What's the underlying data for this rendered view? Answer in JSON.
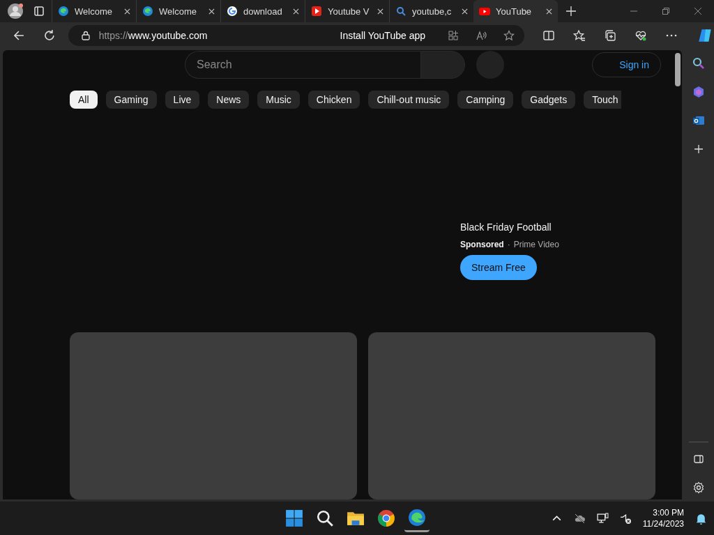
{
  "tabs": [
    {
      "title": "Welcome",
      "kind": "edge",
      "selected": false
    },
    {
      "title": "Welcome",
      "kind": "edge",
      "selected": false
    },
    {
      "title": "download",
      "kind": "google",
      "selected": false
    },
    {
      "title": "Youtube V",
      "kind": "play-square",
      "selected": false
    },
    {
      "title": "youtube,c",
      "kind": "search",
      "selected": false
    },
    {
      "title": "YouTube",
      "kind": "youtube",
      "selected": true
    }
  ],
  "address_bar": {
    "url_scheme": "https://",
    "url_host": "www.youtube.com",
    "install_label": "Install YouTube app"
  },
  "page": {
    "search": {
      "placeholder": "Search"
    },
    "sign_in": "Sign in",
    "chips": [
      {
        "label": "All",
        "selected": true
      },
      {
        "label": "Gaming",
        "selected": false
      },
      {
        "label": "Live",
        "selected": false
      },
      {
        "label": "News",
        "selected": false
      },
      {
        "label": "Music",
        "selected": false
      },
      {
        "label": "Chicken",
        "selected": false
      },
      {
        "label": "Chill-out music",
        "selected": false
      },
      {
        "label": "Camping",
        "selected": false
      },
      {
        "label": "Gadgets",
        "selected": false
      },
      {
        "label": "Touch",
        "selected": false
      }
    ],
    "ad": {
      "title": "Black Friday Football",
      "sponsored": "Sponsored",
      "separator": "·",
      "advertiser": "Prime Video",
      "button": "Stream Free"
    }
  },
  "taskbar": {
    "apps": [
      {
        "kind": "windows",
        "active": false
      },
      {
        "kind": "search",
        "active": false
      },
      {
        "kind": "folder",
        "active": false
      },
      {
        "kind": "chrome",
        "active": false
      },
      {
        "kind": "edge",
        "active": true
      }
    ],
    "time": "3:00 PM",
    "date": "11/24/2023"
  }
}
